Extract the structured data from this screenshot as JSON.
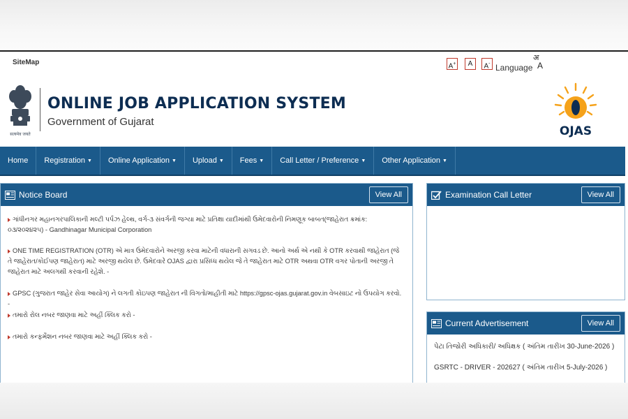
{
  "utility": {
    "sitemap": "SiteMap",
    "font_increase": "A",
    "font_normal": "A",
    "font_decrease": "A",
    "language": "Language",
    "lang_glyph_1": "अ",
    "lang_glyph_2": "A"
  },
  "header": {
    "title": "ONLINE JOB APPLICATION SYSTEM",
    "subtitle": "Government of Gujarat",
    "emblem_motto": "सत्यमेव जयते",
    "logo_text": "OJAS"
  },
  "nav": {
    "items": [
      {
        "label": "Home",
        "dropdown": false
      },
      {
        "label": "Registration",
        "dropdown": true
      },
      {
        "label": "Online Application",
        "dropdown": true
      },
      {
        "label": "Upload",
        "dropdown": true
      },
      {
        "label": "Fees",
        "dropdown": true
      },
      {
        "label": "Call Letter / Preference",
        "dropdown": true
      },
      {
        "label": "Other Application",
        "dropdown": true
      }
    ]
  },
  "notice_board": {
    "title": "Notice Board",
    "view_all": "View All",
    "items": [
      "ગાંધીનગર મહાનગરપાલિકાની મલ્ટી પર્પઝ હેલ્થ, વર્ગ-૩ સંવર્ગની જગ્યા માટે પ્રતિક્ષા યાદીમાંથી ઉમેદવારોની નિમણૂક બાબત(જાહેરાત ક્રમાંક: ૦૩/૨૦૨૪૨૫) - Gandhinagar Municipal Corporation",
      "ONE TIME REGISTRATION (OTR) એ માત્ર ઉમેદવારોને અરજી કરવા માટેની વધારાની સગવડ છે. આનો અર્થ એ નથી કે OTR કરવાથી જાહેરાત (જે તે જાહેરાત/કોઈપણ જાહેરાત) માટે અરજી થયેલ છે. ઉમેદવારે OJAS દ્વારા પ્રસિધ્ધ થયેલ જે તે જાહેરાત માટે OTR અથવા OTR વગર પોતાની અરજી તે જાહેરાત માટે અલગથી કરવાની રહેશે. -",
      "GPSC (ગુજરાત જાહેર સેવા આયોગ) ને લગતી કોઇપણ જાહેરાત ની વિગતો/માહીતી માટે https://gpsc-ojas.gujarat.gov.in વેબસાઇટ નો ઉપયોગ કરવો. -",
      "તમારો રોલ નબર જાણવા માટે અહીં ક્લિક કરો -",
      "તમારો કન્ફર્મેશન નબર જાણવા માટે અહીં ક્લિક કરો -"
    ]
  },
  "exam_call_letter": {
    "title": "Examination Call Letter",
    "view_all": "View All"
  },
  "current_advertisement": {
    "title": "Current Advertisement",
    "view_all": "View All",
    "items": [
      "પેટા તિજોરી અધિકારી/ અધિક્ષક ( અંતિમ તારીખ 30-June-2026 )",
      "GSRTC - DRIVER - 202627 ( અંતિમ તારીખ 5-July-2026 )"
    ]
  },
  "colors": {
    "nav_blue": "#1b5a8b",
    "title_navy": "#0d2d52",
    "bullet_red": "#c0392b",
    "logo_orange": "#f5a21a"
  }
}
